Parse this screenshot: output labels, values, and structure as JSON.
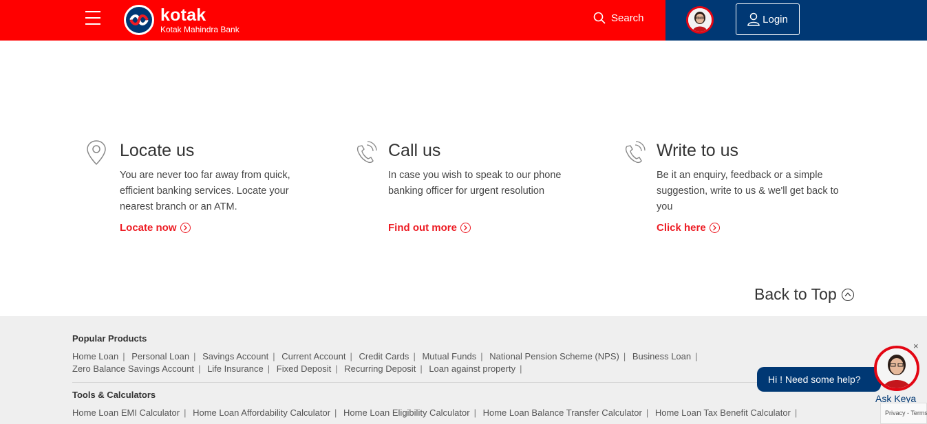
{
  "header": {
    "menu_icon": "hamburger-icon",
    "logo": {
      "name": "kotak",
      "subtitle": "Kotak Mahindra Bank"
    },
    "search_label": "Search",
    "login_label": "Login",
    "colors": {
      "red": "#ff0000",
      "navy": "#003874"
    }
  },
  "contact_cards": [
    {
      "icon": "map-pin-icon",
      "title": "Locate us",
      "description": "You are never too far away from quick, efficient banking services. Locate your nearest branch or an ATM.",
      "link": "Locate now"
    },
    {
      "icon": "phone-icon",
      "title": "Call us",
      "description": "In case you wish to speak to our phone banking officer for urgent resolution",
      "link": "Find out more"
    },
    {
      "icon": "phone-icon",
      "title": "Write to us",
      "description": "Be it an enquiry, feedback or a simple suggestion, write to us & we'll get back to you",
      "link": "Click here"
    }
  ],
  "back_to_top": "Back to Top",
  "footer": {
    "popular_products": {
      "title": "Popular Products",
      "links": [
        "Home Loan",
        "Personal Loan",
        "Savings Account",
        "Current Account",
        "Credit Cards",
        "Mutual Funds",
        "National Pension Scheme (NPS)",
        "Business Loan",
        "Zero Balance Savings Account",
        "Life Insurance",
        "Fixed Deposit",
        "Recurring Deposit",
        "Loan against property"
      ]
    },
    "tools_calculators": {
      "title": "Tools & Calculators",
      "links": [
        "Home Loan EMI Calculator",
        "Home Loan Affordability Calculator",
        "Home Loan Eligibility Calculator",
        "Home Loan Balance Transfer Calculator",
        "Home Loan Tax Benefit Calculator"
      ]
    }
  },
  "chat_widget": {
    "bubble_text": "Hi ! Need some help?",
    "name_label": "Ask Keya",
    "close_label": "×"
  },
  "recaptcha": {
    "text": "Privacy - Terms"
  }
}
